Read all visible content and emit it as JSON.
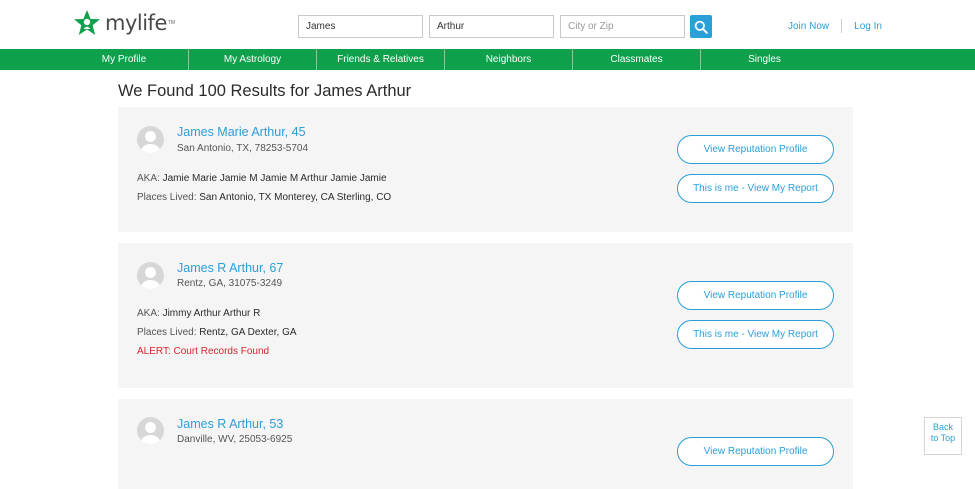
{
  "brand": {
    "logo_text": "mylife",
    "tm": "TM",
    "accent": "#0ea04b",
    "link_color": "#2a9fd8"
  },
  "search": {
    "first_name_value": "James",
    "last_name_value": "Arthur",
    "location_placeholder": "City or Zip",
    "button_icon": "search-icon"
  },
  "header_links": {
    "join": "Join Now",
    "login": "Log In"
  },
  "nav": [
    "My Profile",
    "My Astrology",
    "Friends & Relatives",
    "Neighbors",
    "Classmates",
    "Singles"
  ],
  "results": {
    "title": "We Found 100 Results for James Arthur",
    "items": [
      {
        "name": "James Marie Arthur, 45",
        "location": "San Antonio, TX, 78253-5704",
        "aka_label": "AKA:",
        "aka": "Jamie Marie Jamie M Jamie M Arthur Jamie Jamie",
        "places_label": "Places Lived:",
        "places": "San Antonio, TX Monterey, CA Sterling, CO",
        "btn_profile": "View Reputation Profile",
        "btn_me": "This is me - View My Report"
      },
      {
        "name": "James R Arthur, 67",
        "location": "Rentz, GA, 31075-3249",
        "aka_label": "AKA:",
        "aka": "Jimmy Arthur Arthur R",
        "places_label": "Places Lived:",
        "places": "Rentz, GA Dexter, GA",
        "alert": "ALERT: Court Records Found",
        "btn_profile": "View Reputation Profile",
        "btn_me": "This is me - View My Report"
      },
      {
        "name": "James R Arthur, 53",
        "location": "Danville, WV, 25053-6925",
        "btn_profile": "View Reputation Profile"
      }
    ]
  },
  "back_to_top": {
    "line1": "Back",
    "line2": "to Top"
  }
}
